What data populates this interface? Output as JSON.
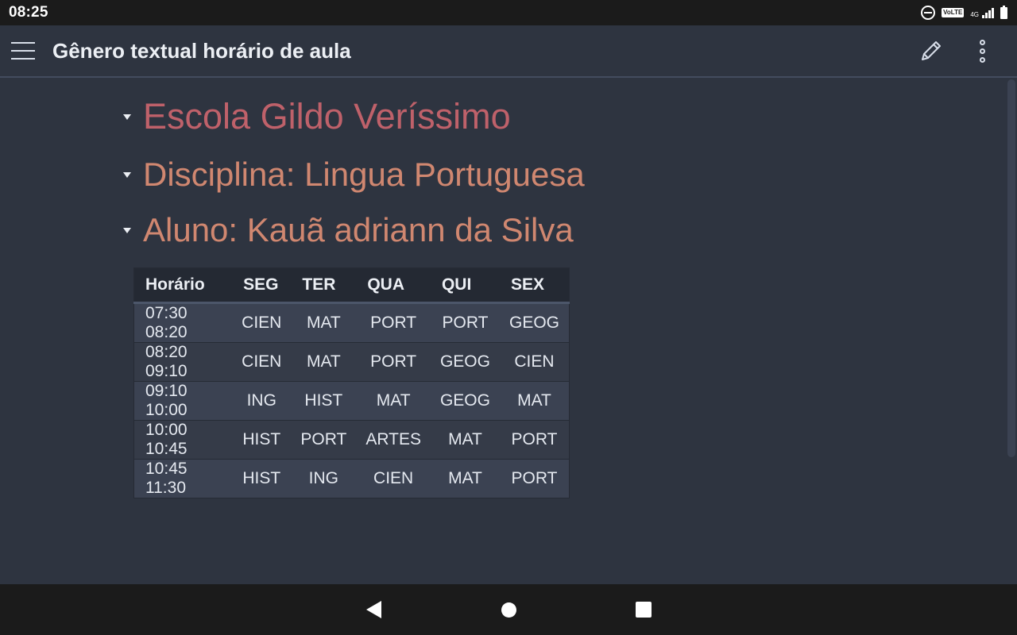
{
  "status_bar": {
    "time": "08:25",
    "icons": [
      "do-not-disturb-icon",
      "volte-icon",
      "4g-icon",
      "signal-icon",
      "battery-icon"
    ],
    "volte_label": "VoLTE",
    "network_label": "4G"
  },
  "app_bar": {
    "title": "Gênero textual horário de aula",
    "menu_icon": "hamburger-menu-icon",
    "edit_icon": "pencil-icon",
    "overflow_icon": "more-vertical-icon"
  },
  "document": {
    "heading1": "Escola Gildo Veríssimo",
    "heading2": "Disciplina: Lingua Portuguesa",
    "heading3": "Aluno: Kauã adriann da Silva",
    "table": {
      "headers": [
        "Horário",
        "SEG",
        "TER",
        "QUA",
        "QUI",
        "SEX"
      ],
      "rows": [
        [
          "07:30 08:20",
          "CIEN",
          "MAT",
          "PORT",
          "PORT",
          "GEOG"
        ],
        [
          "08:20 09:10",
          "CIEN",
          "MAT",
          "PORT",
          "GEOG",
          "CIEN"
        ],
        [
          "09:10 10:00",
          "ING",
          "HIST",
          "MAT",
          "GEOG",
          "MAT"
        ],
        [
          "10:00 10:45",
          "HIST",
          "PORT",
          "ARTES",
          "MAT",
          "PORT"
        ],
        [
          "10:45 11:30",
          "HIST",
          "ING",
          "CIEN",
          "MAT",
          "PORT"
        ]
      ]
    }
  },
  "nav_bar": {
    "icons": [
      "back-icon",
      "home-icon",
      "recents-icon"
    ]
  },
  "colors": {
    "background": "#2e3440",
    "heading1": "#bf616a",
    "heading2": "#d08770",
    "bars": "#1b1b1b"
  }
}
